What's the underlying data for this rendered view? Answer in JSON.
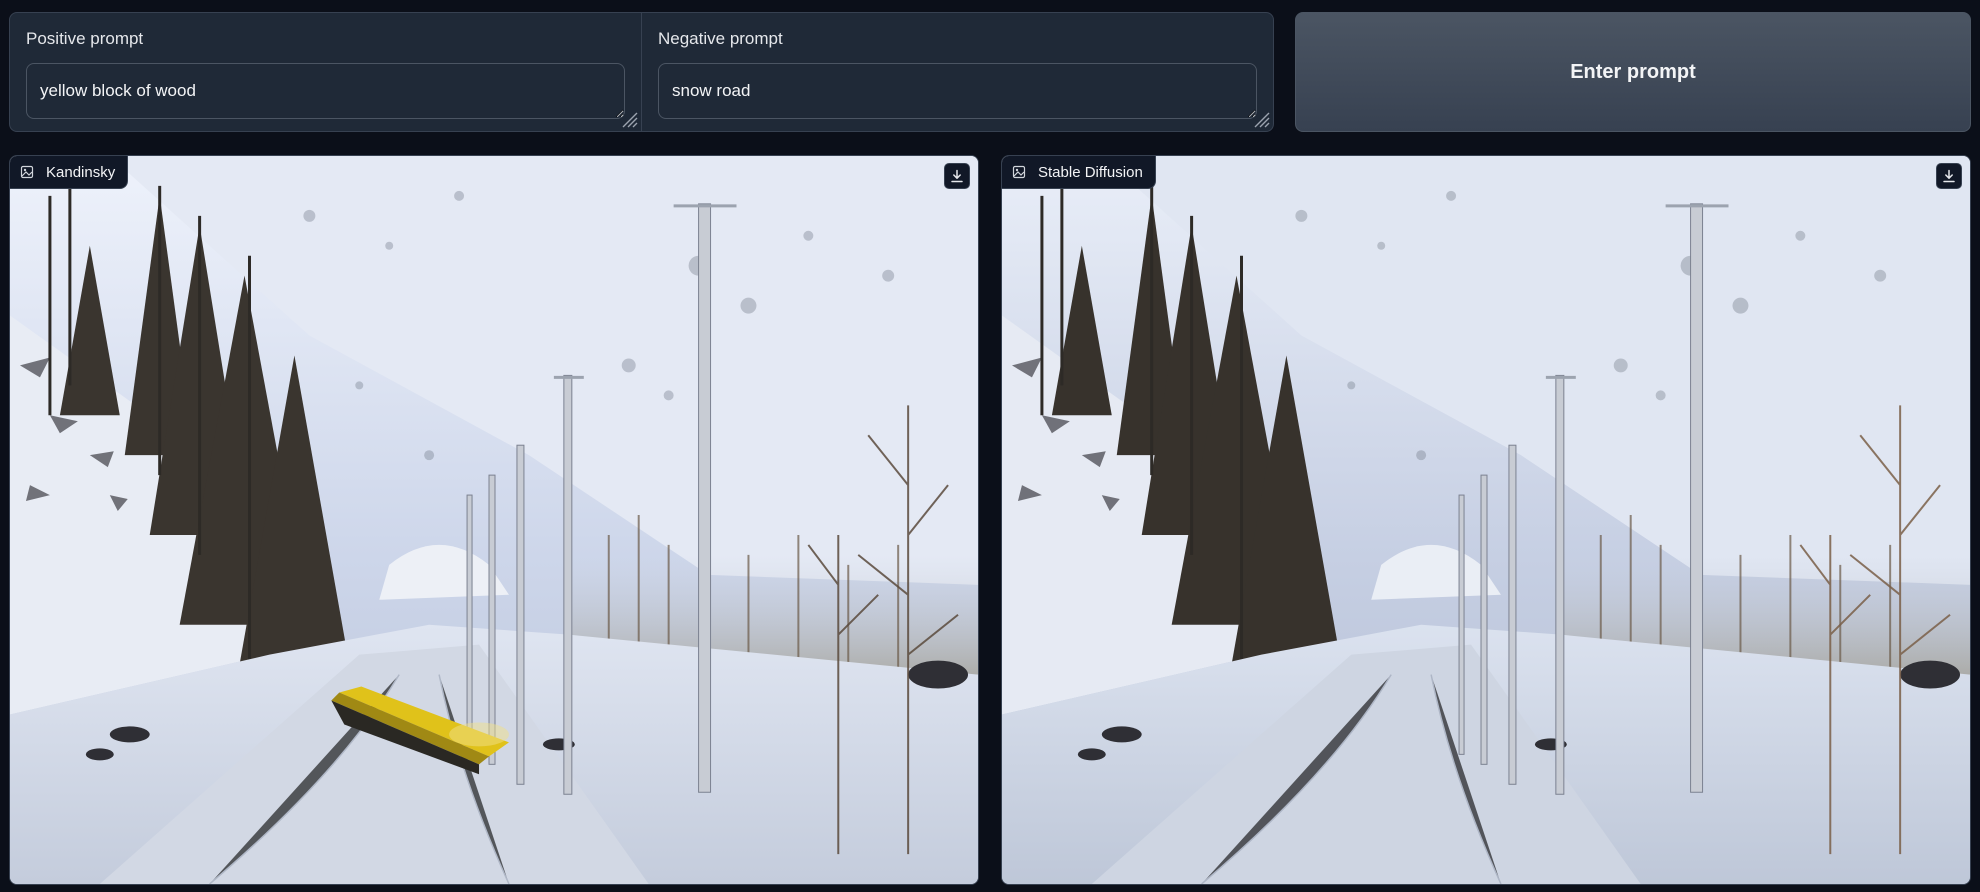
{
  "prompts": {
    "positive": {
      "label": "Positive prompt",
      "value": "yellow block of wood"
    },
    "negative": {
      "label": "Negative prompt",
      "value": "snow road"
    }
  },
  "enter_button": {
    "label": "Enter prompt"
  },
  "outputs": [
    {
      "label": "Kandinsky",
      "icon": "image-icon",
      "download_icon": "download-icon"
    },
    {
      "label": "Stable Diffusion",
      "icon": "image-icon",
      "download_icon": "download-icon"
    }
  ],
  "colors": {
    "background": "#0b0f19",
    "panel": "#1f2937",
    "border": "#374151",
    "button": "#4b5563",
    "yellow_block": "#e0c21a"
  }
}
